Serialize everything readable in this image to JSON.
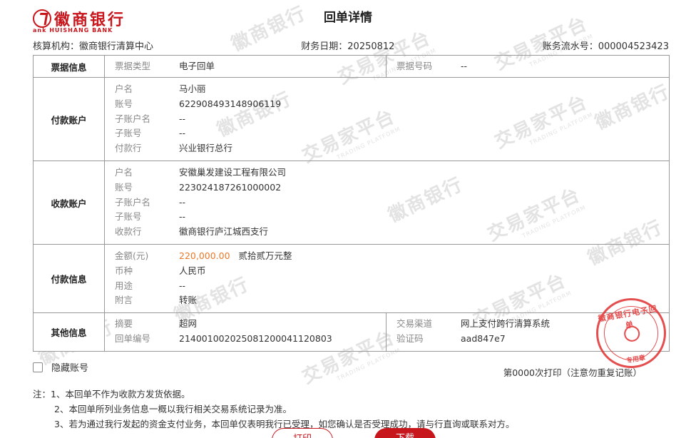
{
  "bank": {
    "name_cn": "徽商银行",
    "name_en": "HUISHANG BANK",
    "logo_glyph": "ank"
  },
  "title": "回单详情",
  "meta": {
    "org": "核算机构：徽商银行清算中心",
    "date": "财务日期：20250812",
    "serial": "账务流水号：000004523423"
  },
  "receipt_info": {
    "section": "票据信息",
    "type_label": "票据类型",
    "type_value": "电子回单",
    "no_label": "票据号码",
    "no_value": "--"
  },
  "payer": {
    "section": "付款账户",
    "rows": [
      {
        "k": "户名",
        "v": "马小丽"
      },
      {
        "k": "账号",
        "v": "622908493148906119"
      },
      {
        "k": "子账户名",
        "v": "--"
      },
      {
        "k": "子账号",
        "v": "--"
      },
      {
        "k": "付款行",
        "v": "兴业银行总行"
      }
    ]
  },
  "payee": {
    "section": "收款账户",
    "rows": [
      {
        "k": "户名",
        "v": "安徽巢发建设工程有限公司"
      },
      {
        "k": "账号",
        "v": "223024187261000002"
      },
      {
        "k": "子账户名",
        "v": "--"
      },
      {
        "k": "子账号",
        "v": "--"
      },
      {
        "k": "收款行",
        "v": "徽商银行庐江城西支行"
      }
    ]
  },
  "payment": {
    "section": "付款信息",
    "amount_label": "金额(元)",
    "amount": "220,000.00",
    "amount_cn": "贰拾贰万元整",
    "currency_label": "币种",
    "currency": "人民币",
    "purpose_label": "用途",
    "purpose": "--",
    "note_label": "附言",
    "note": "转账"
  },
  "other": {
    "section": "其他信息",
    "summary_label": "摘要",
    "summary": "超网",
    "receipt_no_label": "回单编号",
    "receipt_no": "21400100202508120004112080​3",
    "channel_label": "交易渠道",
    "channel": "网上支付跨行清算系统",
    "code_label": "验证码",
    "code": "aad847e7"
  },
  "stamp": {
    "text_top": "徽商银行电子回单",
    "text_bottom": "专用章"
  },
  "hide_account_label": "隐藏账号",
  "print_count": "第0000次打印（注意勿重复记账）",
  "notes": [
    "注：1、本回单不作为收款方发货依据。",
    "2、本回单所列业务信息一概以我行相关交易系统记录为准。",
    "3、若为通过我行发起的资金支付业务，本回单仅表明我行已受理，如您确认是否受理成功，请与行直询或联系对方。"
  ],
  "buttons": {
    "print": "打印",
    "download": "下载"
  },
  "watermark": {
    "cn": "交易家平台",
    "en": "TRADING PLATFORM",
    "bank": "徽商银行"
  },
  "colors": {
    "brand": "#c8161d",
    "amount": "#e8782a",
    "stamp": "#e03030"
  }
}
